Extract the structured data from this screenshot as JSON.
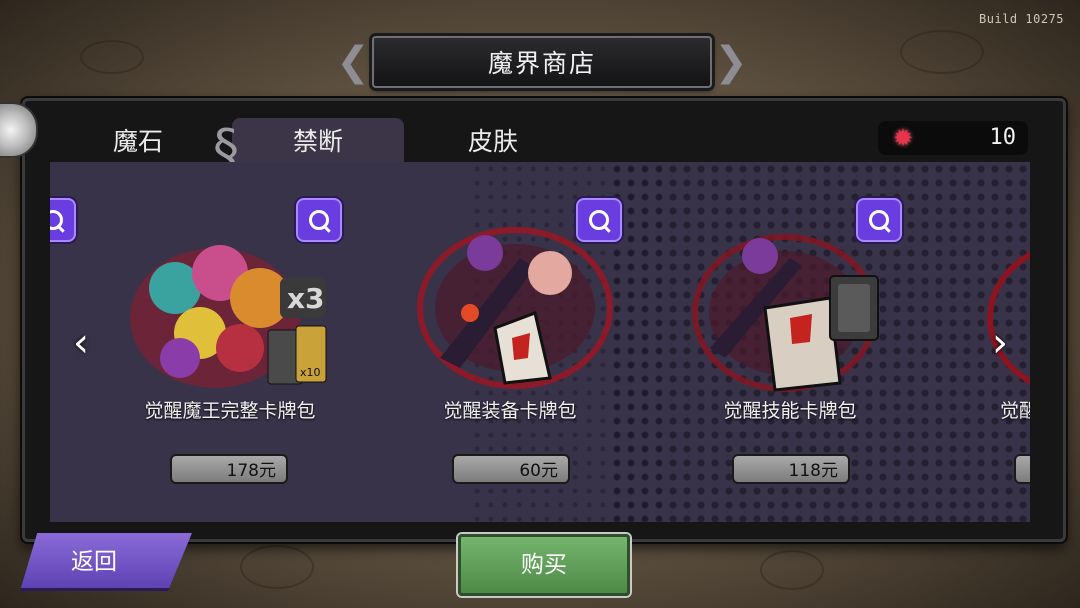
{
  "build": "Build 10275",
  "title": "魔界商店",
  "tabs": [
    {
      "label": "魔石",
      "active": false
    },
    {
      "label": "禁断",
      "active": true
    },
    {
      "label": "皮肤",
      "active": false
    }
  ],
  "currency": {
    "icon": "red-gem-icon",
    "value": "10"
  },
  "products": [
    {
      "name": "觉醒魔王完整卡牌包",
      "price": "178元"
    },
    {
      "name": "觉醒装备卡牌包",
      "price": "60元"
    },
    {
      "name": "觉醒技能卡牌包",
      "price": "118元"
    },
    {
      "name": "觉醒",
      "price": ""
    }
  ],
  "badge_x3": "x3",
  "badge_x10": "x10",
  "buttons": {
    "back": "返回",
    "buy": "购买"
  },
  "nav": {
    "prev": "‹",
    "next": "›"
  },
  "colors": {
    "accent_purple": "#6a3de0",
    "buy_green": "#5d9c56",
    "gem_red": "#e8334a"
  }
}
